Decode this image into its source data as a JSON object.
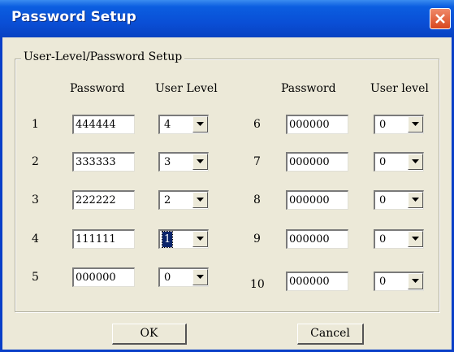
{
  "window": {
    "title": "Password Setup"
  },
  "group": {
    "label": "User-Level/Password Setup"
  },
  "headers": {
    "password_left": "Password",
    "level_left": "User Level",
    "password_right": "Password",
    "level_right": "User level"
  },
  "rows": [
    {
      "num": "1",
      "password": "444444",
      "level": "4"
    },
    {
      "num": "2",
      "password": "333333",
      "level": "3"
    },
    {
      "num": "3",
      "password": "222222",
      "level": "2"
    },
    {
      "num": "4",
      "password": "111111",
      "level": "1"
    },
    {
      "num": "5",
      "password": "000000",
      "level": "0"
    },
    {
      "num": "6",
      "password": "000000",
      "level": "0"
    },
    {
      "num": "7",
      "password": "000000",
      "level": "0"
    },
    {
      "num": "8",
      "password": "000000",
      "level": "0"
    },
    {
      "num": "9",
      "password": "000000",
      "level": "0"
    },
    {
      "num": "10",
      "password": "000000",
      "level": "0"
    }
  ],
  "buttons": {
    "ok": "OK",
    "cancel": "Cancel"
  },
  "colors": {
    "titlebar": "#0a4fd6",
    "face": "#ece9d8",
    "selection": "#0a246a",
    "close": "#d8461e"
  }
}
